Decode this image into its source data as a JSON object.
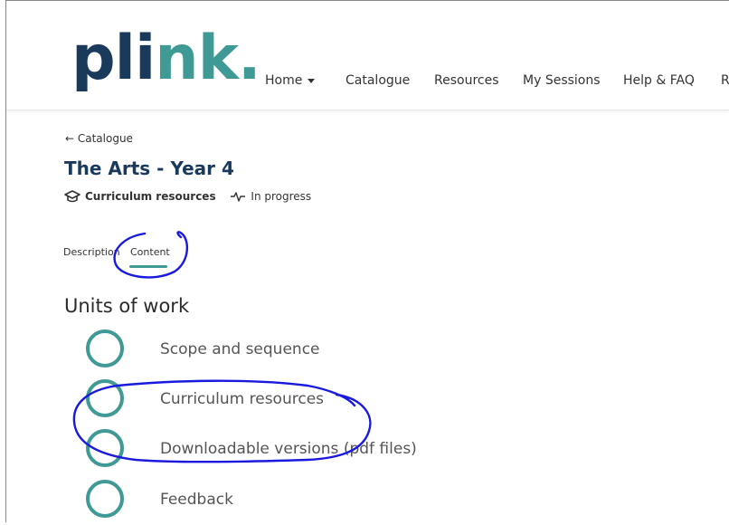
{
  "brand": {
    "logo_part1": "pli",
    "logo_part2": "nk."
  },
  "nav": {
    "items": [
      {
        "label": "Home",
        "has_dropdown": true
      },
      {
        "label": "Catalogue"
      },
      {
        "label": "Resources"
      },
      {
        "label": "My Sessions"
      },
      {
        "label": "Help & FAQ"
      },
      {
        "label": "R"
      }
    ]
  },
  "breadcrumb": {
    "back_label": "← Catalogue"
  },
  "course": {
    "title": "The Arts - Year 4",
    "type_label": "Curriculum resources",
    "status_label": "In progress"
  },
  "tabs": [
    {
      "label": "Description"
    },
    {
      "label": "Content",
      "active": true
    }
  ],
  "section": {
    "title": "Units of work"
  },
  "units": [
    {
      "label": "Scope and sequence"
    },
    {
      "label": "Curriculum resources"
    },
    {
      "label": "Downloadable versions (pdf files)"
    },
    {
      "label": "Feedback"
    }
  ],
  "colors": {
    "brand_navy": "#1a3a5c",
    "brand_teal": "#3f9a96",
    "annotation_blue": "#1a1adf"
  }
}
